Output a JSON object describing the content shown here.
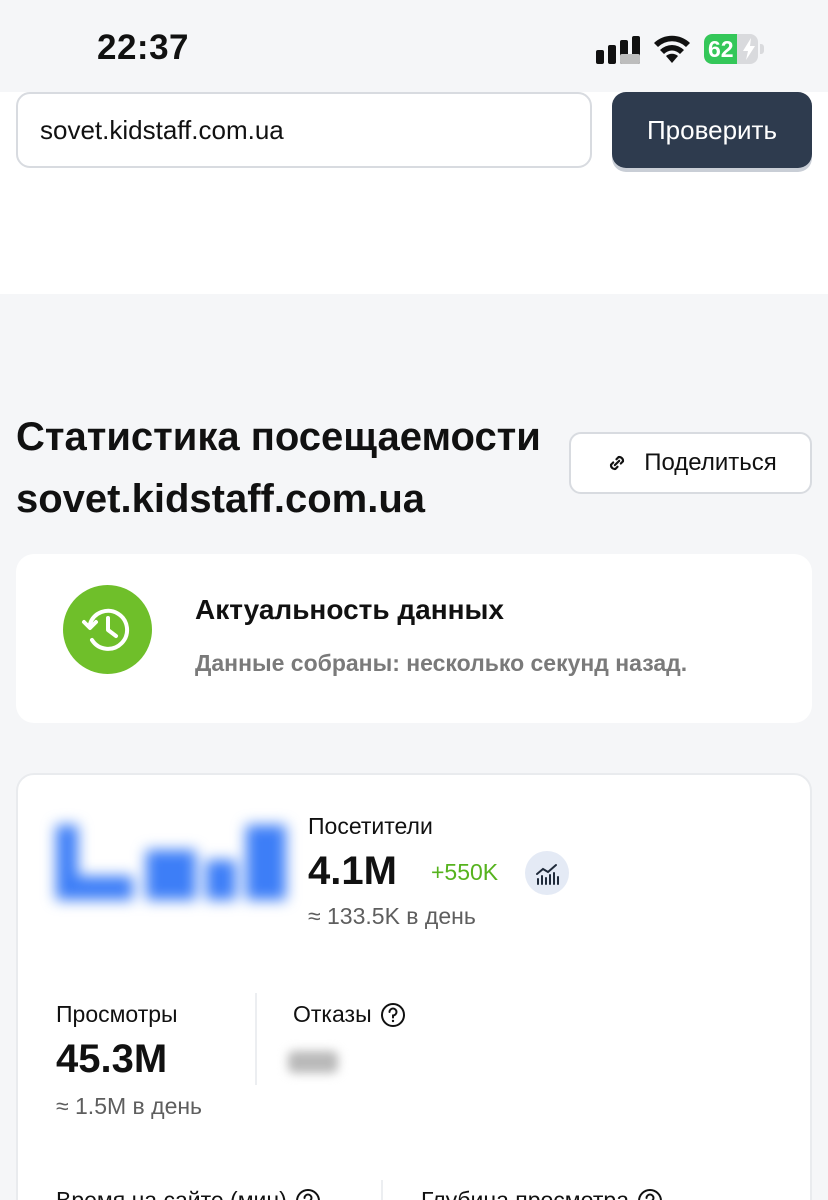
{
  "status_bar": {
    "time": "22:37",
    "battery_percent": "62",
    "battery_level": 0.62,
    "icons": [
      "signal-icon",
      "wifi-icon",
      "battery-charging-icon"
    ]
  },
  "search": {
    "value": "sovet.kidstaff.com.ua",
    "button_label": "Проверить"
  },
  "header": {
    "title_line1": "Статистика посещаемости",
    "title_line2": "sovet.kidstaff.com.ua",
    "share_label": "Поделиться",
    "share_icon": "link-icon"
  },
  "freshness": {
    "title": "Актуальность данных",
    "subtitle": "Данные собраны: несколько секунд назад.",
    "icon": "history-clock-icon",
    "accent_color": "#6fbf2a"
  },
  "stats": {
    "visitors": {
      "label": "Посетители",
      "value": "4.1M",
      "delta": "+550K",
      "per_day": "≈ 133.5K в день",
      "delta_color": "#56b31e"
    },
    "views": {
      "label": "Просмотры",
      "value": "45.3M",
      "per_day": "≈ 1.5M в день"
    },
    "bounces": {
      "label": "Отказы"
    },
    "time_on_site": {
      "label": "Время на сайте (мин)"
    },
    "depth": {
      "label": "Глубина просмотра"
    }
  },
  "colors": {
    "button_dark": "#2e3b4e",
    "background": "#f5f6f8",
    "chart_blue": "#3d7ef7"
  }
}
